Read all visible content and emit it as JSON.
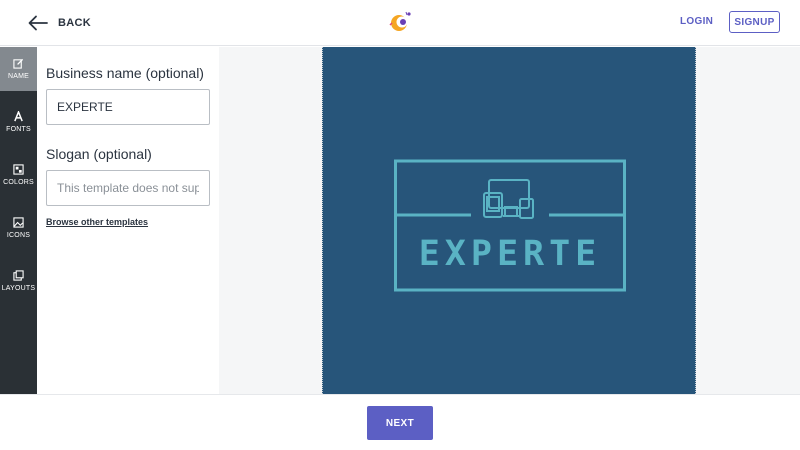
{
  "header": {
    "back_label": "BACK",
    "login_label": "LOGIN",
    "signup_label": "SIGNUP"
  },
  "sidebar": {
    "items": [
      {
        "label": "NAME",
        "icon": "edit-icon",
        "active": true
      },
      {
        "label": "FONTS",
        "icon": "font-icon",
        "active": false
      },
      {
        "label": "COLORS",
        "icon": "palette-icon",
        "active": false
      },
      {
        "label": "ICONS",
        "icon": "image-icon",
        "active": false
      },
      {
        "label": "LAYOUTS",
        "icon": "layouts-icon",
        "active": false
      }
    ]
  },
  "form": {
    "business_name_label": "Business name (optional)",
    "business_name_value": "EXPERTE",
    "slogan_label": "Slogan (optional)",
    "slogan_placeholder": "This template does not supp",
    "browse_label": "Browse other templates"
  },
  "preview": {
    "logo_text": "EXPERTE",
    "icon": "devices-icon",
    "background_color": "#27557a",
    "line_color": "#5ab3c4"
  },
  "footer": {
    "next_label": "NEXT"
  },
  "colors": {
    "accent": "#5c5fc4",
    "rail_bg": "#2a3035",
    "rail_active": "#83898f"
  }
}
